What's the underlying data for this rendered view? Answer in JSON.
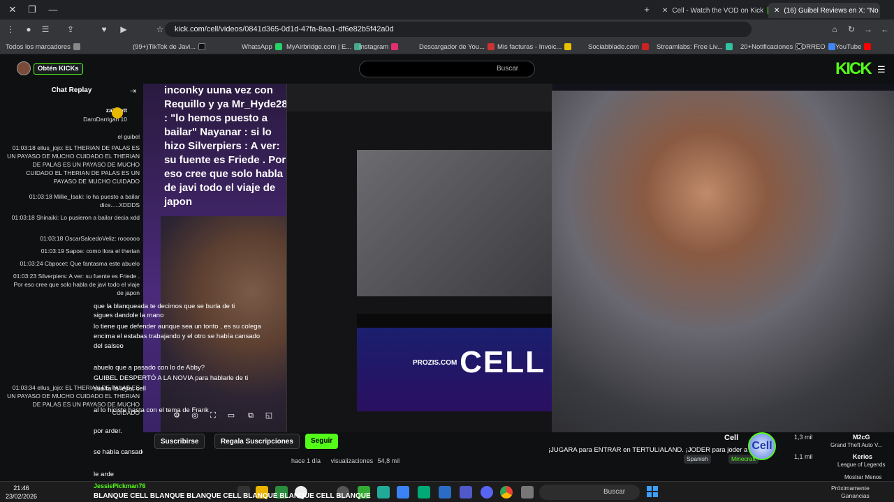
{
  "browser": {
    "tabs": [
      {
        "label": "(16) Guibel Reviews en X: \"No"
      },
      {
        "label": "Cell - Watch the VOD on Kick"
      }
    ],
    "url": "kick.com/cell/videos/0841d365-0d1d-47fa-8aa1-df6e82b5f42a0d",
    "bookmarks": [
      "Todos los marcadores",
      "(99+)TikTok de Javi...",
      "WhatsApp",
      "MyAirbridge.com | E...",
      "Instagram",
      "Descargador de You...",
      "Mis facturas - Invoic...",
      "Sociabblade.com",
      "Streamlabs: Free Liv...",
      "20+Notificaciones",
      "CORREO",
      "YouTube"
    ]
  },
  "kick": {
    "get_kick": "Obtén KICKs",
    "search_placeholder": "Buscar",
    "logo": "KICK"
  },
  "chat": {
    "title": "Chat Replay",
    "pinned": [
      "zaicrott",
      "DaroDarrigan 10",
      "marcelo_mvp 5"
    ],
    "messages": [
      "el guibel",
      "01:03:18 ellus_jojo: EL THERIAN DE PALAS ES UN PAYASO DE MUCHO CUIDADO EL THERIAN DE PALAS ES UN PAYASO DE MUCHO CUIDADO EL THERIAN DE PALAS ES UN PAYASO DE MUCHO CUIDADO",
      "01:03:18 Millie_Isaki: lo ha puesto a bailar dice.....XDDDS",
      "01:03:18 Shinaiki: Lo pusieron a bailar decia xdd",
      "01:03:18 OscarSalcedoVeliz: roooooo",
      "01:03:19 Sapoe: como llora el therian",
      "01:03:24 Cbpocet: Que fantasma este abuelo",
      "01:03:23 Silverpiers: A ver: su fuente es Friede . Por eso cree que solo habla de javi todo el viaje de japon",
      "01:03:34 ellus_jojo: EL THERIAN DE PALAS ES UN PAYASO DE MUCHO CUIDADO EL THERIAN DE PALAS ES UN PAYASO DE MUCHO CUIDADO"
    ]
  },
  "overlay": {
    "top_text": "inconky uuna vez con Requillo y ya Mr_Hyde28 : \"lo hemos puesto a bailar\" Nayanar : si lo hizo Silverpiers : A ver: su fuente es Friede . Por eso cree que solo habla de javi todo el viaje de japon",
    "chat_lines": [
      "que la blanqueada te decimos que se burla de ti",
      "sigues dandole la mano",
      "lo tiene que defender aunque sea un tonto , es su colega",
      "encima el estabas trabajando y el otro se había cansado",
      "del salseo",
      "abuelo que a pasado con lo de Abby?",
      "GUIBEL DESPERTÓ A LA NOVIA para hablarle de ti",
      "suelta la lejía, cell",
      "al lo hiciste hasta con el tema de Frank",
      "por arder.",
      "se había cansado del salseo según, y hasta le tiro el cell",
      "le arde"
    ],
    "banner_text": "CELL",
    "banner_site": "PROZIS.COM"
  },
  "info": {
    "follow": "Seguir",
    "gift": "Regala Suscripciones",
    "subscribe": "Suscribirse",
    "views": "54,8 mil",
    "views_label": "visualizaciones",
    "ago": "hace 1 día",
    "channel": "Cell",
    "title": "¡JUGARA para ENTRAR en TERTULIALAND. ¡JODER para joder a Cell!",
    "category": "Minecraft",
    "language": "Spanish",
    "avatar_text": "Cell",
    "recommended": [
      {
        "name": "M2cG",
        "sub": "Grand Theft Auto V...",
        "count": "1,3 mil"
      },
      {
        "name": "Kerios",
        "sub": "League of Legends",
        "count": "1,1 mil"
      }
    ],
    "show_less": "Mostrar Menos",
    "upcoming": "Próximamente",
    "earnings": "Ganancias"
  },
  "taskbar": {
    "time": "21:46",
    "date": "23/02/2026",
    "search_placeholder": "Buscar",
    "spam_user": "JessiePickman76",
    "spam_text": "BLANQUE CELL BLANQUE BLANQUE CELL BLANQUE BLANQUE CELL BLANQUE",
    "notify_badge": "28"
  }
}
